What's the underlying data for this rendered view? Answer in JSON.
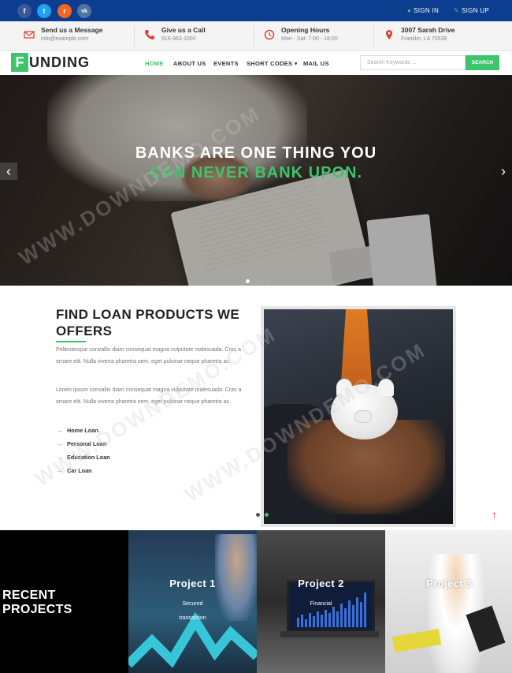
{
  "topbar": {
    "social": [
      {
        "icon": "facebook-icon",
        "glyph": "f",
        "color": "#3b5998"
      },
      {
        "icon": "twitter-icon",
        "glyph": "t",
        "color": "#1da1f2"
      },
      {
        "icon": "rss-icon",
        "glyph": "r",
        "color": "#f26522"
      },
      {
        "icon": "vk-icon",
        "glyph": "vk",
        "color": "#4c75a3"
      }
    ],
    "sign_in": "SIGN IN",
    "sign_up": "SIGN UP"
  },
  "info": {
    "message_title": "Send us a Message",
    "message_value": "info@example.com",
    "call_title": "Give us a Call",
    "call_value": "919-963-1000",
    "hours_title": "Opening Hours",
    "hours_value": "Mon - Sat: 7:00 - 18:00",
    "address_title": "3007 Sarah Drive",
    "address_value": "Franklin, LA 70538",
    "accent": "#e63b2e"
  },
  "nav": {
    "logo_letter": "F",
    "logo_rest": "UNDING",
    "items": [
      "HOME",
      "ABOUT US",
      "EVENTS",
      "SHORT CODES ▾",
      "MAIL US"
    ],
    "search_placeholder": "Search Keywords ...",
    "search_button": "SEARCH"
  },
  "hero": {
    "line1": "BANKS ARE ONE THING YOU",
    "line2": "CAN NEVER BANK UPON.",
    "prev": "‹",
    "next": "›"
  },
  "loan": {
    "title": "FIND LOAN PRODUCTS WE OFFERS",
    "para1": "Pellentesque convallis diam consequat magna vulputate malesuada. Cras a ornare elit. Nulla viverra pharetra sem, eget pulvinar neque pharetra ac.",
    "para2": "Lorem Ipsum convallis diam consequat magna vulputate malesuada. Cras a ornare elit. Nulla viverra pharetra sem, eget pulvinar neque pharetra ac.",
    "items": [
      "Home Loan.",
      "Personal Loan",
      "Education Loan",
      "Car Loan"
    ]
  },
  "projects": {
    "title": "RECENT PROJECTS",
    "cards": [
      {
        "title": "Project 1",
        "sub1": "Secured",
        "sub2": "transaction"
      },
      {
        "title": "Project 2",
        "sub1": "Financial",
        "sub2": ""
      },
      {
        "title": "Project 3",
        "sub1": "",
        "sub2": ""
      }
    ]
  },
  "watermark": "WWW.DOWNDEMO.COM",
  "colors": {
    "brand_green": "#3ec46d",
    "topbar_blue": "#0c3d8f"
  }
}
